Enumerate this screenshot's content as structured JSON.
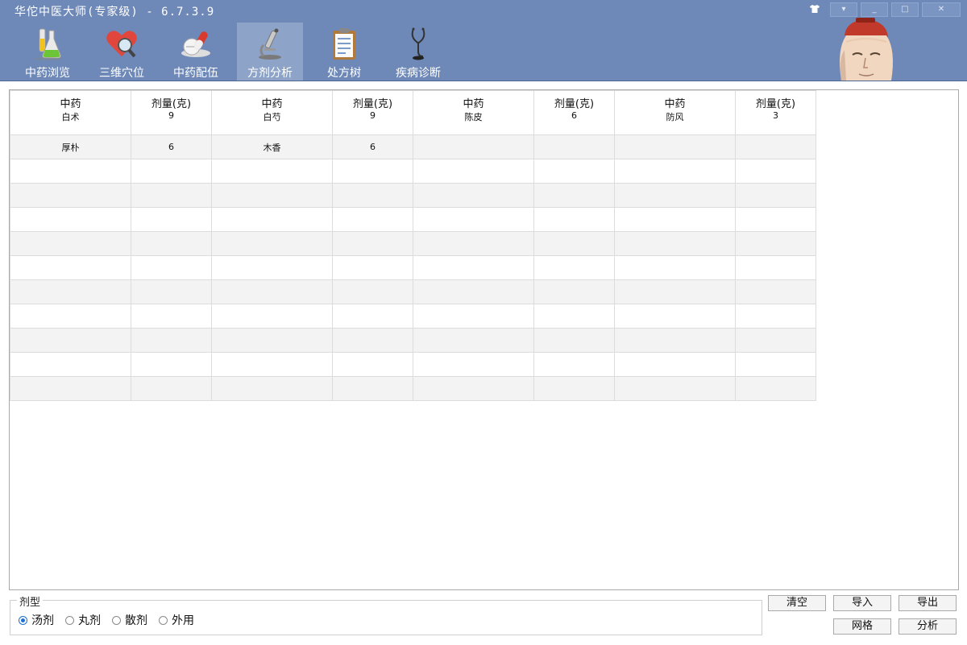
{
  "window": {
    "title": "华佗中医大师(专家级) - 6.7.3.9",
    "controls": {
      "skin": "skin-shirt-icon",
      "dropdown": "▾",
      "minimize": "_",
      "maximize": "□",
      "close": "✕"
    }
  },
  "toolbar": {
    "items": [
      {
        "label": "中药浏览",
        "icon": "flask-icon"
      },
      {
        "label": "三维穴位",
        "icon": "heart-magnifier-icon"
      },
      {
        "label": "中药配伍",
        "icon": "pill-capsule-icon"
      },
      {
        "label": "方剂分析",
        "icon": "microscope-icon",
        "active": true
      },
      {
        "label": "处方树",
        "icon": "clipboard-icon"
      },
      {
        "label": "疾病诊断",
        "icon": "stethoscope-icon"
      }
    ]
  },
  "grid": {
    "headers": [
      "中药",
      "剂量(克)",
      "中药",
      "剂量(克)",
      "中药",
      "剂量(克)",
      "中药",
      "剂量(克)"
    ],
    "rows": [
      [
        "白术",
        "9",
        "白芍",
        "9",
        "陈皮",
        "6",
        "防风",
        "3"
      ],
      [
        "厚朴",
        "6",
        "木香",
        "6",
        "",
        "",
        "",
        ""
      ],
      [
        "",
        "",
        "",
        "",
        "",
        "",
        "",
        ""
      ],
      [
        "",
        "",
        "",
        "",
        "",
        "",
        "",
        ""
      ],
      [
        "",
        "",
        "",
        "",
        "",
        "",
        "",
        ""
      ],
      [
        "",
        "",
        "",
        "",
        "",
        "",
        "",
        ""
      ],
      [
        "",
        "",
        "",
        "",
        "",
        "",
        "",
        ""
      ],
      [
        "",
        "",
        "",
        "",
        "",
        "",
        "",
        ""
      ],
      [
        "",
        "",
        "",
        "",
        "",
        "",
        "",
        ""
      ],
      [
        "",
        "",
        "",
        "",
        "",
        "",
        "",
        ""
      ],
      [
        "",
        "",
        "",
        "",
        "",
        "",
        "",
        ""
      ],
      [
        "",
        "",
        "",
        "",
        "",
        "",
        "",
        ""
      ]
    ]
  },
  "dosage_form": {
    "legend": "剂型",
    "options": [
      "汤剂",
      "丸剂",
      "散剂",
      "外用"
    ],
    "selected": "汤剂"
  },
  "buttons": {
    "clear": "清空",
    "import": "导入",
    "export": "导出",
    "grid": "网格",
    "analyze": "分析"
  },
  "colors": {
    "chrome": "#6e89b8",
    "active_tab": "#8da3c8",
    "radio_accent": "#1e6fd0"
  }
}
